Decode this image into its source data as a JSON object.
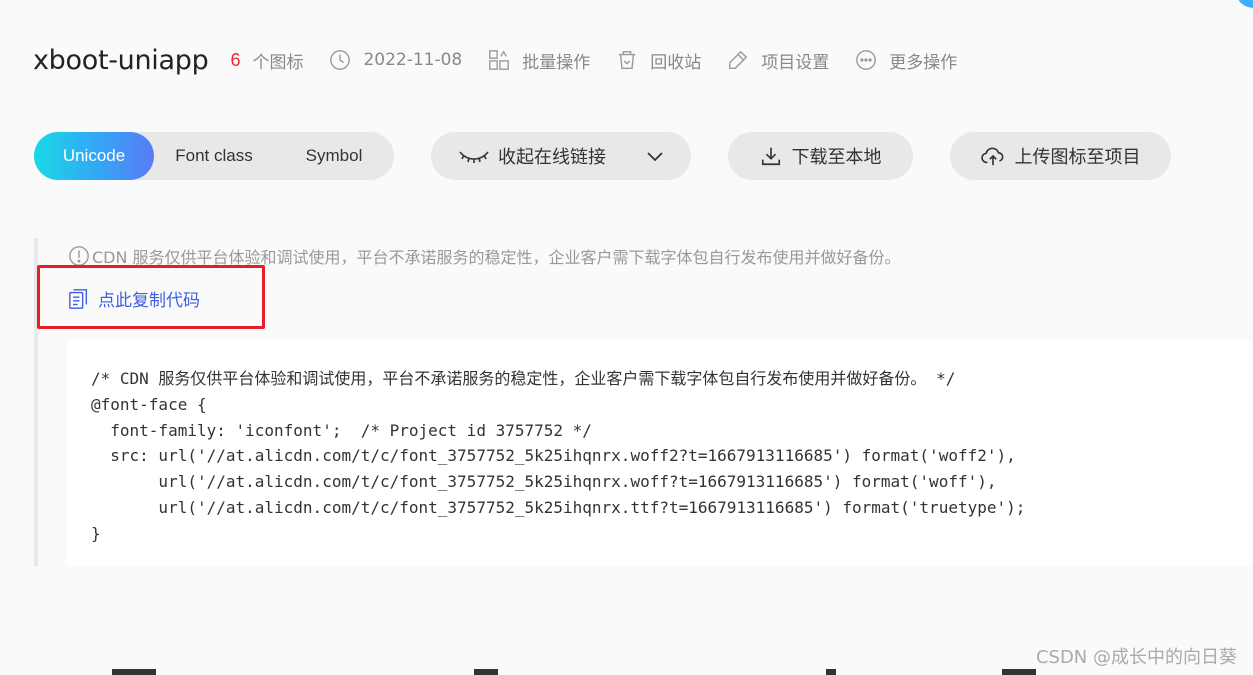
{
  "header": {
    "project_title": "xboot-uniapp",
    "icon_count": "6",
    "icon_count_label": "个图标",
    "date": "2022-11-08",
    "batch_ops": "批量操作",
    "recycle_bin": "回收站",
    "project_settings": "项目设置",
    "more_ops": "更多操作"
  },
  "toolbar": {
    "tabs": [
      {
        "label": "Unicode",
        "active": true
      },
      {
        "label": "Font class",
        "active": false
      },
      {
        "label": "Symbol",
        "active": false
      }
    ],
    "collapse_link": "收起在线链接",
    "download_local": "下载至本地",
    "upload_icons": "上传图标至项目"
  },
  "content": {
    "cdn_notice": "CDN 服务仅供平台体验和调试使用，平台不承诺服务的稳定性，企业客户需下载字体包自行发布使用并做好备份。",
    "copy_code": "点此复制代码",
    "code": "/* CDN 服务仅供平台体验和调试使用，平台不承诺服务的稳定性，企业客户需下载字体包自行发布使用并做好备份。 */\n@font-face {\n  font-family: 'iconfont';  /* Project id 3757752 */\n  src: url('//at.alicdn.com/t/c/font_3757752_5k25ihqnrx.woff2?t=1667913116685') format('woff2'),\n       url('//at.alicdn.com/t/c/font_3757752_5k25ihqnrx.woff?t=1667913116685') format('woff'),\n       url('//at.alicdn.com/t/c/font_3757752_5k25ihqnrx.ttf?t=1667913116685') format('truetype');\n}"
  },
  "watermark": "CSDN @成长中的向日葵",
  "colors": {
    "accent_gradient_start": "#1ad8e6",
    "accent_gradient_end": "#5b7bf6",
    "count_red": "#e6292e",
    "link_blue": "#3d5fe0",
    "highlight_red": "#e81e26"
  }
}
